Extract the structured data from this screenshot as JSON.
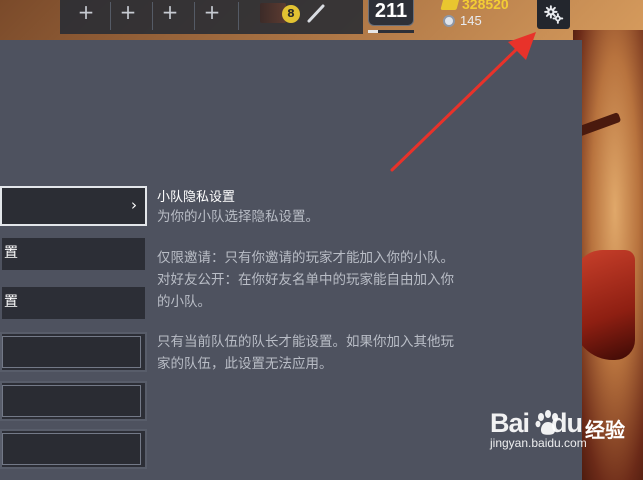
{
  "hud": {
    "loadout_slots": [
      "+",
      "+",
      "+",
      "+"
    ],
    "weapon_badge": "8",
    "level": "211",
    "level_progress": 0.22,
    "coins": "328520",
    "gems": "145",
    "settings_icon": "gear-icon"
  },
  "sidebar": {
    "items": [
      {
        "label": "",
        "selected": true
      },
      {
        "label": "置"
      },
      {
        "label": "置"
      },
      {
        "label": ""
      },
      {
        "label": ""
      },
      {
        "label": ""
      }
    ],
    "chevron": "›"
  },
  "detail": {
    "title": "小队隐私设置",
    "subtitle": "为你的小队选择隐私设置。",
    "invite_only": "仅限邀请：只有你邀请的玩家才能加入你的小队。",
    "friends_open_1": "对好友公开：在你好友名单中的玩家能自由加入你",
    "friends_open_2": "的小队。",
    "leader_note_1": "只有当前队伍的队长才能设置。如果你加入其他玩",
    "leader_note_2": "家的队伍，此设置无法应用。"
  },
  "watermark": {
    "logo": "Bai",
    "logo_tail": "du",
    "zh": "经验",
    "url": "jingyan.baidu.com"
  },
  "colors": {
    "panel": "#4e525f",
    "coin": "#f3cd34",
    "arrow": "#e8322a"
  }
}
